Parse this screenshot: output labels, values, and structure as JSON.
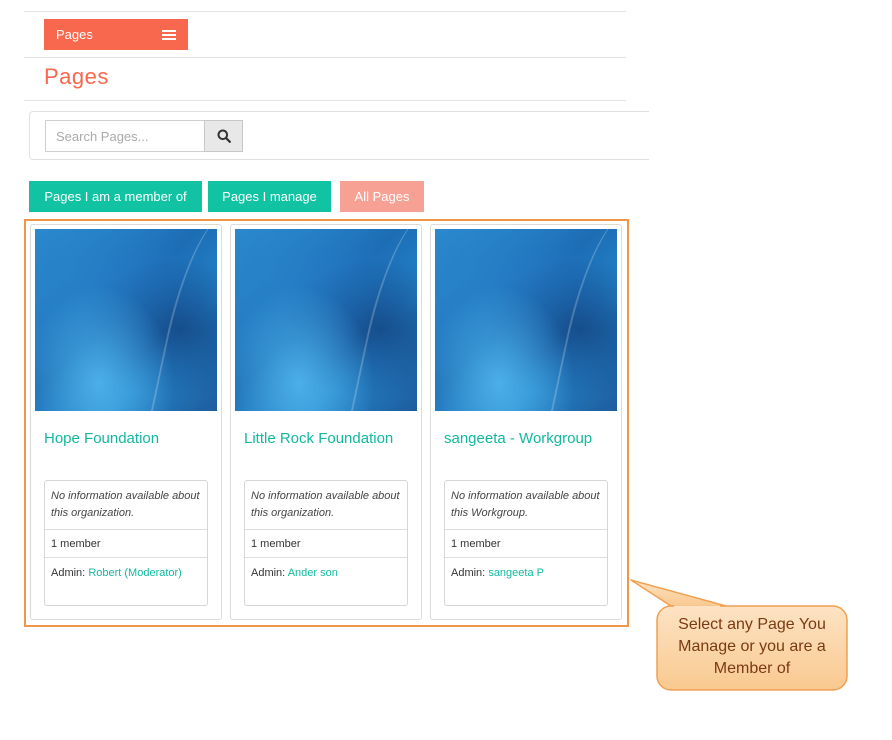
{
  "header": {
    "menu_label": "Pages",
    "page_title": "Pages"
  },
  "search": {
    "placeholder": "Search Pages..."
  },
  "filters": [
    {
      "label": "Pages I am a member of"
    },
    {
      "label": "Pages I manage"
    },
    {
      "label": "All Pages"
    }
  ],
  "cards": [
    {
      "name": "Hope Foundation",
      "description": "No information available about this organization.",
      "members": "1 member",
      "admin_label": "Admin:",
      "admin_name": "Robert (Moderator)"
    },
    {
      "name": "Little Rock Foundation",
      "description": "No information available about this organization.",
      "members": "1 member",
      "admin_label": "Admin:",
      "admin_name": "Ander son"
    },
    {
      "name": "sangeeta - Workgroup",
      "description": "No information available about this Workgroup.",
      "members": "1 member",
      "admin_label": "Admin:",
      "admin_name": "sangeeta P"
    }
  ],
  "callout": {
    "text": "Select any Page You Manage or you are a Member of"
  },
  "colors": {
    "accent": "#f7684f",
    "teal": "#12c3a3",
    "inactive_filter": "#f7a194",
    "highlight_border": "#f0964a",
    "callout_fill": "#fcd8b0"
  }
}
